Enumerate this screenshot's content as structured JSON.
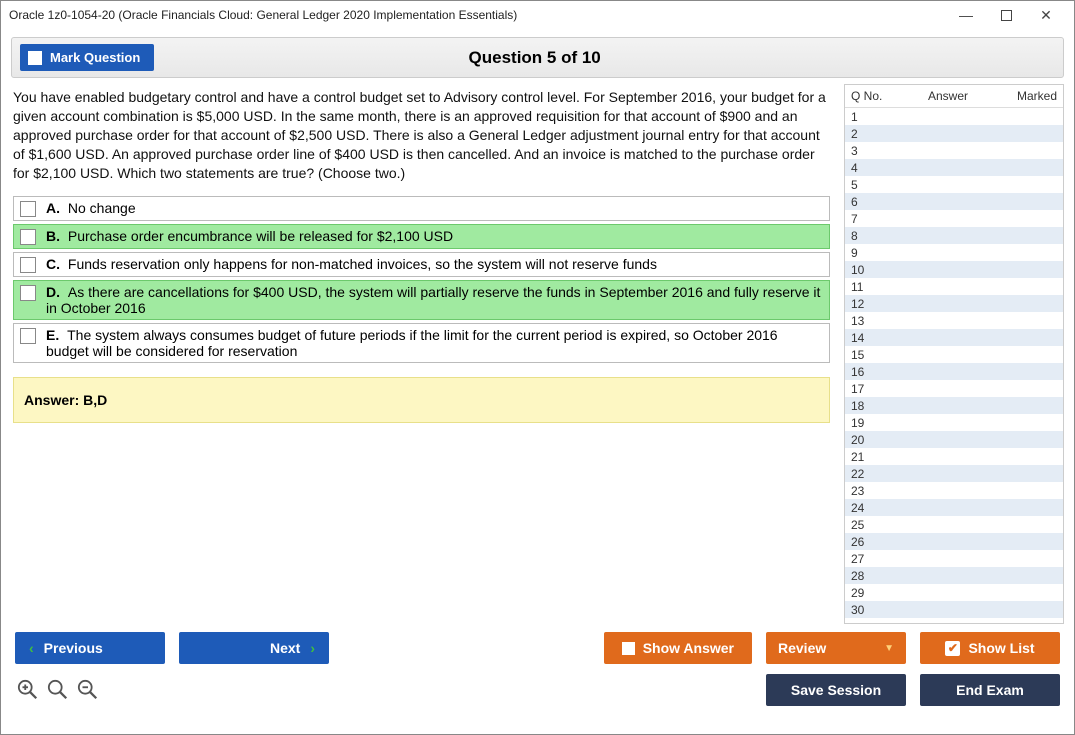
{
  "window": {
    "title": "Oracle 1z0-1054-20 (Oracle Financials Cloud: General Ledger 2020 Implementation Essentials)"
  },
  "header": {
    "mark_label": "Mark Question",
    "question_title": "Question 5 of 10"
  },
  "question": {
    "text": "You have enabled budgetary control and have a control budget set to Advisory control level. For September 2016, your budget for a given account combination is $5,000 USD. In the same month, there is an approved requisition for that account of $900 and an approved purchase order for that account of $2,500 USD. There is also a General Ledger adjustment journal entry for that account of $1,600 USD. An approved purchase order line of $400 USD is then cancelled. And an invoice is matched to the purchase order for $2,100 USD. Which two statements are true? (Choose two.)",
    "options": [
      {
        "letter": "A.",
        "text": "No change",
        "correct": false
      },
      {
        "letter": "B.",
        "text": "Purchase order encumbrance will be released for $2,100 USD",
        "correct": true
      },
      {
        "letter": "C.",
        "text": "Funds reservation only happens for non-matched invoices, so the system will not reserve funds",
        "correct": false
      },
      {
        "letter": "D.",
        "text": "As there are cancellations for $400 USD, the system will partially reserve the funds in September 2016 and fully reserve it in October 2016",
        "correct": true
      },
      {
        "letter": "E.",
        "text": "The system always consumes budget of future periods if the limit for the current period is expired, so October 2016 budget will be considered for reservation",
        "correct": false
      }
    ],
    "answer_label": "Answer: B,D"
  },
  "sidepanel": {
    "col_qno": "Q No.",
    "col_answer": "Answer",
    "col_marked": "Marked",
    "row_count": 30
  },
  "footer": {
    "previous": "Previous",
    "next": "Next",
    "show_answer": "Show Answer",
    "review": "Review",
    "show_list": "Show List",
    "save_session": "Save Session",
    "end_exam": "End Exam"
  }
}
